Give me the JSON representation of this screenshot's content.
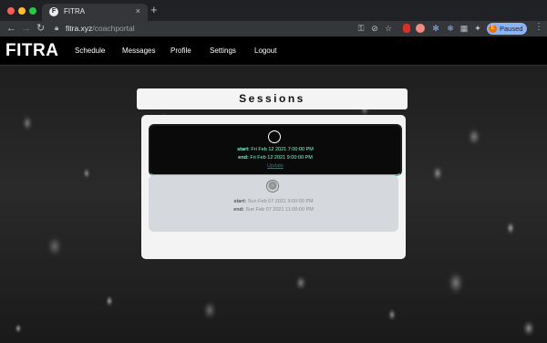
{
  "browser": {
    "tab_title": "FITRA",
    "tab_favicon": "F",
    "tab_close": "×",
    "new_tab": "+",
    "url_host": "fitra.xyz",
    "url_path": "/coachportal",
    "profile_initial": "E",
    "profile_label": "Paused",
    "icons": [
      "back-icon",
      "forward-icon",
      "reload-icon",
      "lock-icon",
      "key-icon",
      "eye-off-icon",
      "star-icon",
      "extension-icon",
      "puzzle-icon",
      "menu-icon"
    ]
  },
  "site": {
    "brand": "FITRA",
    "nav": [
      "Schedule",
      "Messages",
      "Profile",
      "Settings",
      "Logout"
    ]
  },
  "sessions": {
    "title": "Sessions",
    "items": [
      {
        "start_label": "start:",
        "start_value": "Fri Feb 12 2021 7:00:00 PM",
        "end_label": "end:",
        "end_value": "Fri Feb 12 2021 9:00:00 PM",
        "action": "Update"
      },
      {
        "start_label": "start:",
        "start_value": "Sun Feb 07 2021 9:00:00 PM",
        "end_label": "end:",
        "end_value": "Sun Feb 07 2021 11:00:00 PM"
      }
    ]
  },
  "colors": {
    "accent": "#7fffd4",
    "card_border": "#5fb3a7",
    "profile_pill": "#8ab4f8"
  }
}
